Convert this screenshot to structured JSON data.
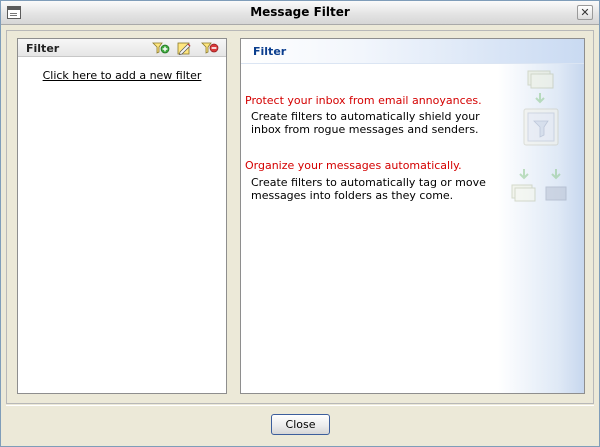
{
  "window": {
    "title": "Message Filter"
  },
  "left_panel": {
    "title": "Filter",
    "add_link": "Click here to add a new filter",
    "toolbar_icons": [
      "add-filter-icon",
      "edit-filter-icon",
      "delete-filter-icon"
    ]
  },
  "right_panel": {
    "title": "Filter",
    "sections": [
      {
        "heading": "Protect your inbox from email annoyances.",
        "text": "Create filters to automatically shield your inbox from rogue messages and senders."
      },
      {
        "heading": "Organize your messages automatically.",
        "text": "Create filters to automatically tag or move messages into folders as they come."
      }
    ]
  },
  "footer": {
    "close_label": "Close"
  },
  "colors": {
    "heading_red": "#d40000",
    "header_blue_text": "#0b3e8e",
    "window_bg": "#ece9d8"
  }
}
